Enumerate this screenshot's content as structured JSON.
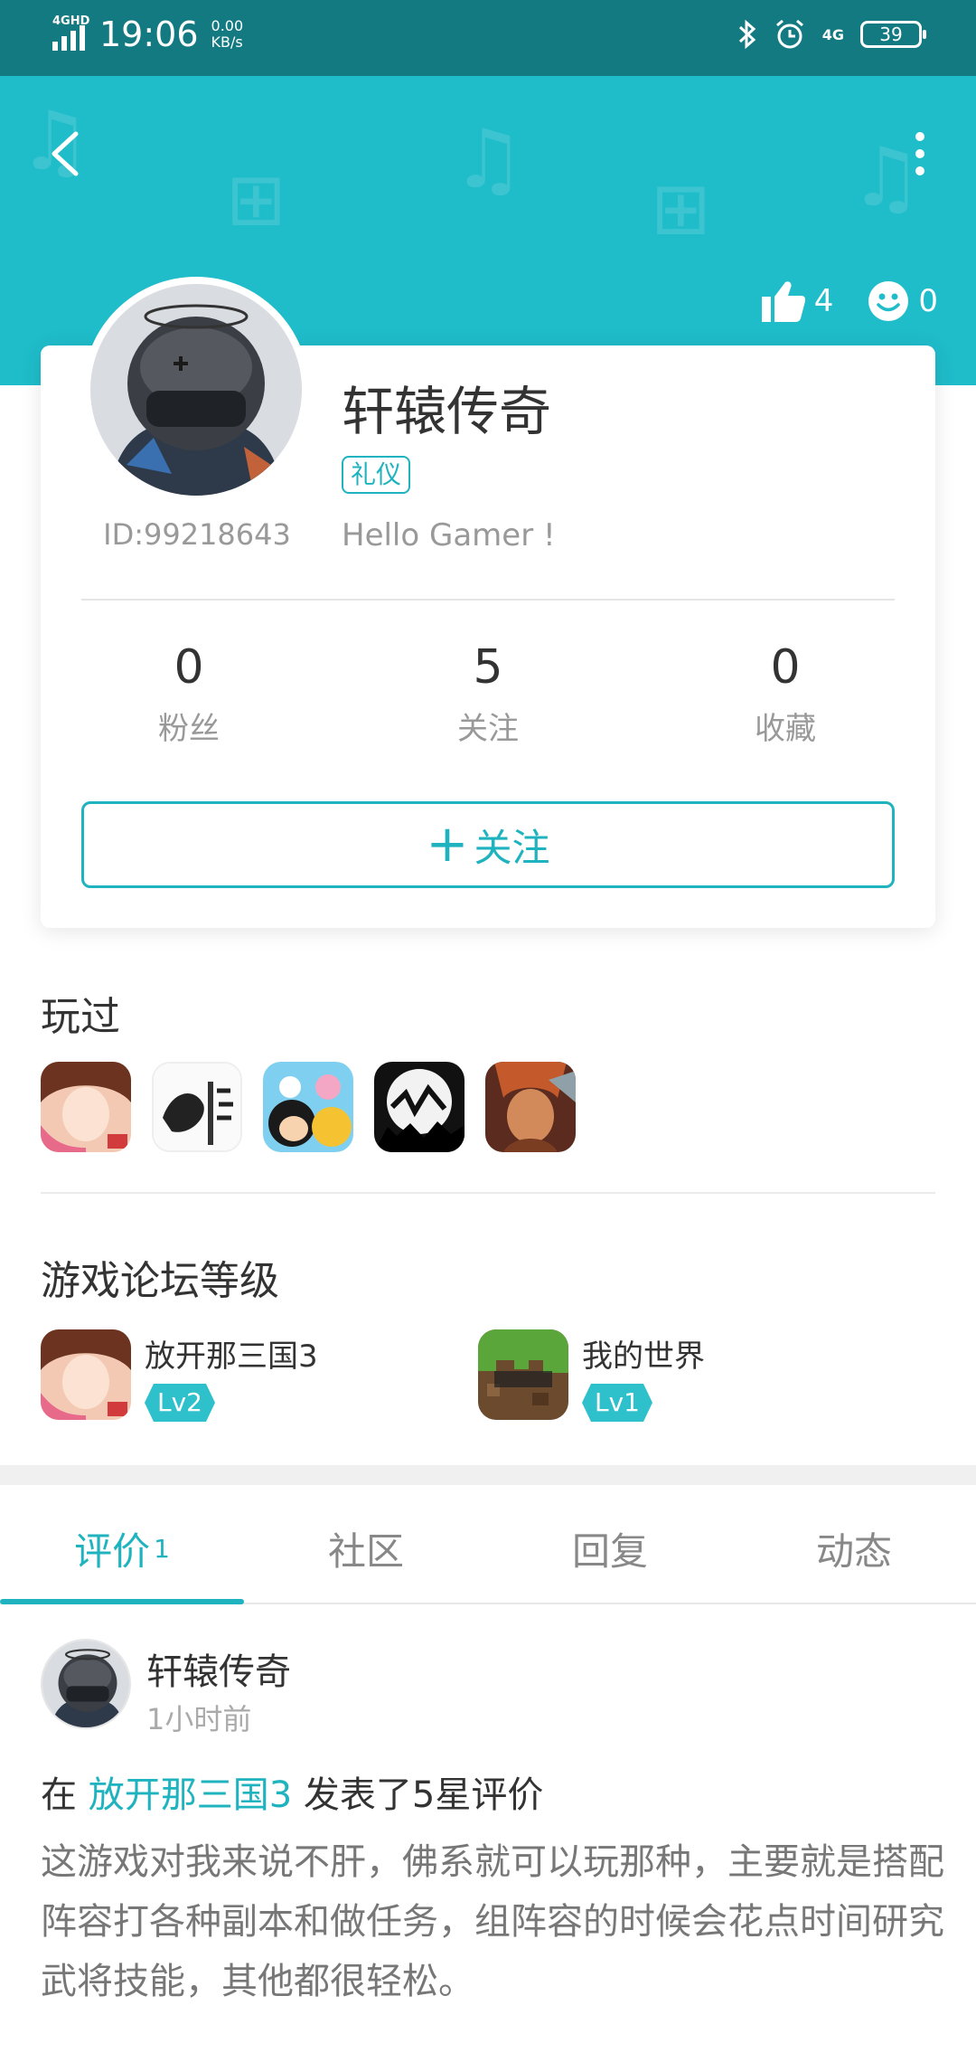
{
  "status_bar": {
    "network_tag": "4GHD",
    "time": "19:06",
    "speed_value": "0.00",
    "speed_unit": "KB/s",
    "net_type": "4G",
    "battery": "39"
  },
  "header": {
    "likes": "4",
    "smiles": "0"
  },
  "profile": {
    "name": "轩辕传奇",
    "badge": "礼仪",
    "id_text": "ID:99218643",
    "bio": "Hello Gamer !",
    "stats": [
      {
        "value": "0",
        "label": "粉丝"
      },
      {
        "value": "5",
        "label": "关注"
      },
      {
        "value": "0",
        "label": "收藏"
      }
    ],
    "follow_label": "关注"
  },
  "played": {
    "title": "玩过"
  },
  "forum_levels": {
    "title": "游戏论坛等级",
    "items": [
      {
        "game": "放开那三国3",
        "level": "Lv2"
      },
      {
        "game": "我的世界",
        "level": "Lv1"
      }
    ]
  },
  "tabs": [
    {
      "label": "评价",
      "count": "1"
    },
    {
      "label": "社区"
    },
    {
      "label": "回复"
    },
    {
      "label": "动态"
    }
  ],
  "post": {
    "user": "轩辕传奇",
    "time": "1小时前",
    "prefix": "在",
    "game_link": "放开那三国3",
    "suffix": "发表了5星评价",
    "body": "这游戏对我来说不肝，佛系就可以玩那种，主要就是搭配阵容打各种副本和做任务，组阵容的时候会花点时间研究武将技能，其他都很轻松。"
  },
  "colors": {
    "accent": "#1fb3bf",
    "header_bg": "#1fbcca",
    "status_bg": "#137a82"
  }
}
